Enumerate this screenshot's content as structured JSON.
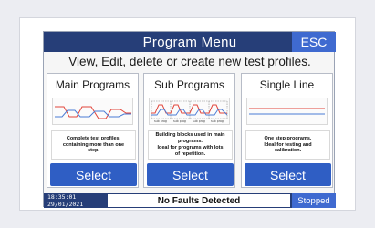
{
  "header": {
    "title": "Program Menu",
    "esc_label": "ESC"
  },
  "subtitle": "View, Edit, delete or create new test profiles.",
  "panels": [
    {
      "title": "Main Programs",
      "description": [
        "Complete test profiles,",
        "containing more than one",
        "step."
      ],
      "select_label": "Select",
      "icon": "main-programs-graph-icon"
    },
    {
      "title": "Sub Programs",
      "description": [
        "Building blocks used in main",
        "programs.",
        "Ideal for programs with lots",
        "of repetition."
      ],
      "select_label": "Select",
      "icon": "sub-programs-graph-icon"
    },
    {
      "title": "Single Line",
      "description": [
        "One step programs.",
        "Ideal for testing and",
        "calibration."
      ],
      "select_label": "Select",
      "icon": "single-line-graph-icon"
    }
  ],
  "status": {
    "time": "18:35:01",
    "date": "29/01/2021",
    "faults": "No Faults Detected",
    "state": "Stopped"
  },
  "colors": {
    "header": "#263e78",
    "accent": "#3f6ad0",
    "button": "#2f5ec4",
    "graph_red": "#e2453b",
    "graph_blue": "#4a7bd4"
  }
}
